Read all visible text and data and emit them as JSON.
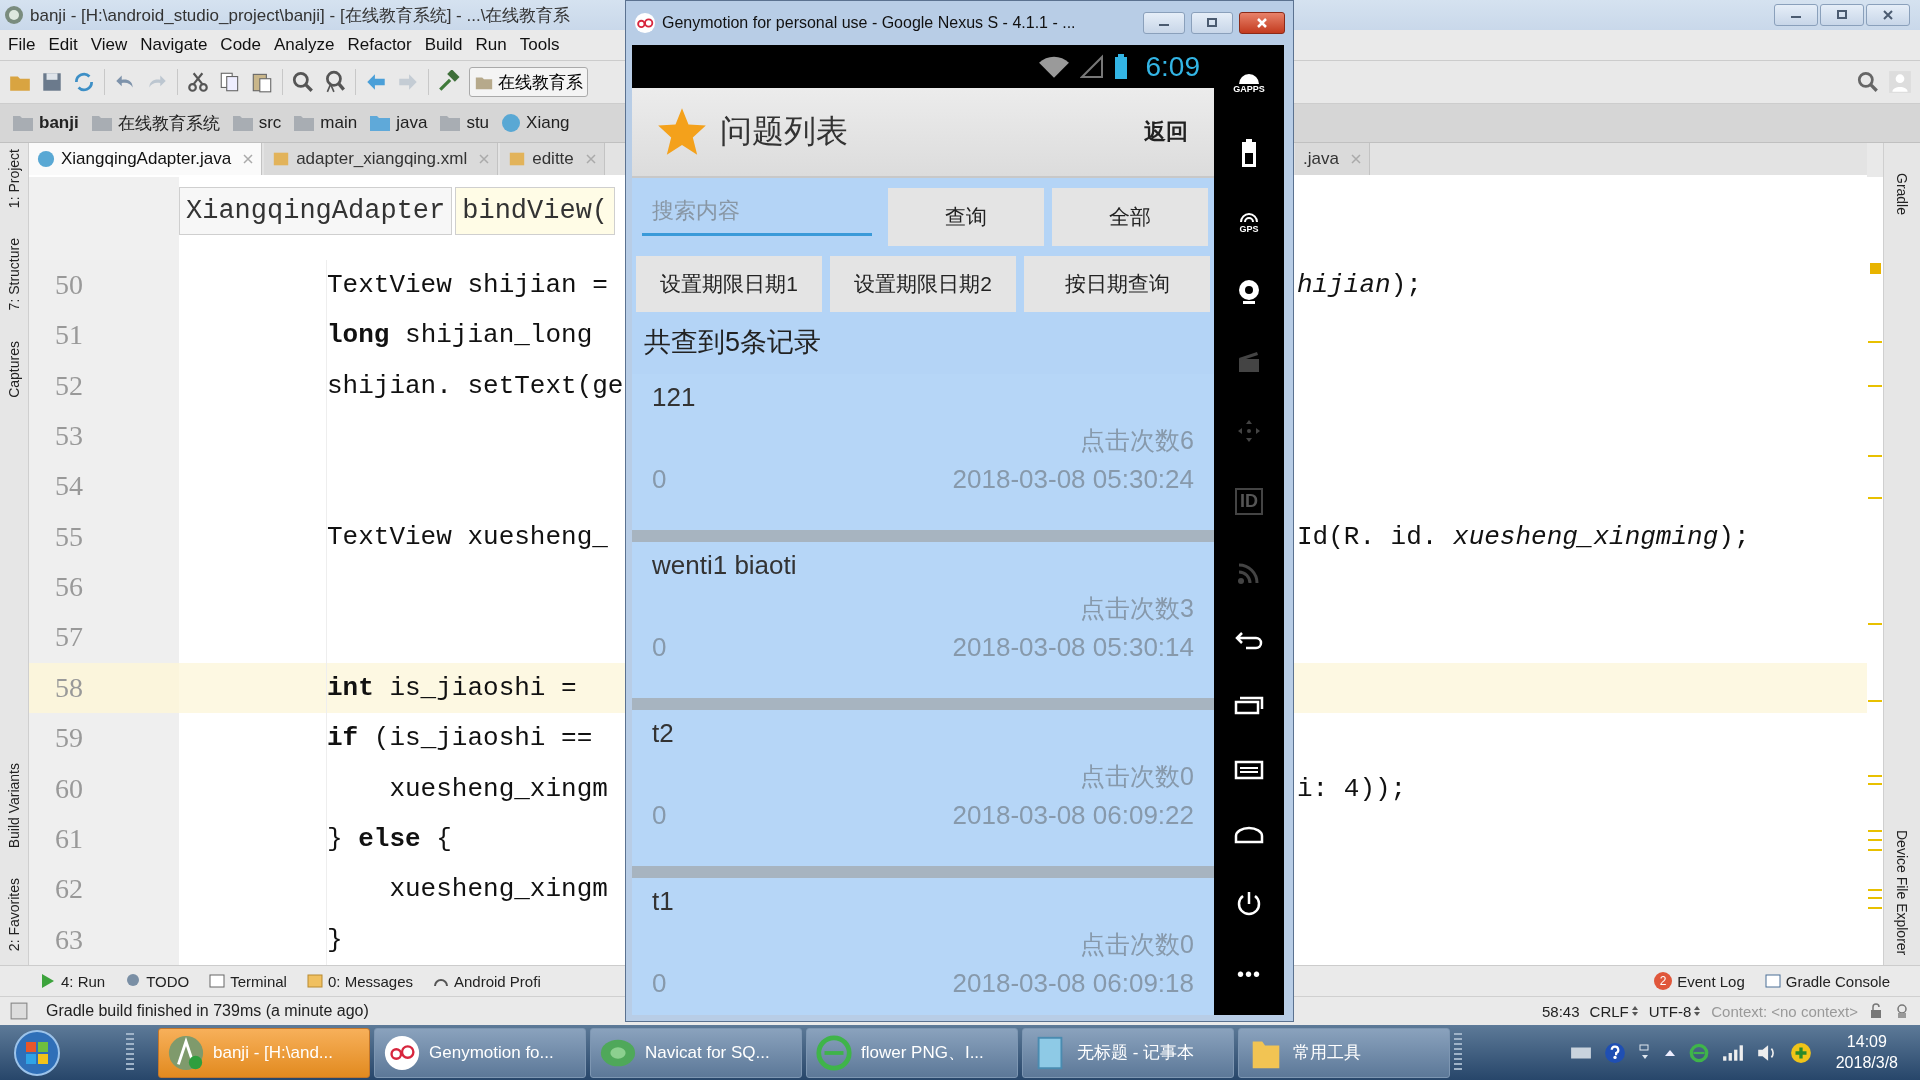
{
  "ide": {
    "title": "banji - [H:\\android_studio_project\\banji] - [在线教育系统] - ...\\在线教育系",
    "menu": [
      "File",
      "Edit",
      "View",
      "Navigate",
      "Code",
      "Analyze",
      "Refactor",
      "Build",
      "Run",
      "Tools"
    ],
    "run_config": "在线教育系",
    "breadcrumb": [
      {
        "label": "banji",
        "kind": "module"
      },
      {
        "label": "在线教育系统",
        "kind": "folder"
      },
      {
        "label": "src",
        "kind": "folder"
      },
      {
        "label": "main",
        "kind": "folder"
      },
      {
        "label": "java",
        "kind": "source"
      },
      {
        "label": "stu",
        "kind": "package"
      },
      {
        "label": "Xiang",
        "kind": "class"
      }
    ],
    "tabs": [
      {
        "label": "XiangqingAdapter.java",
        "kind": "java",
        "selected": true
      },
      {
        "label": "adapter_xiangqing.xml",
        "kind": "xml",
        "selected": false
      },
      {
        "label": "editte",
        "kind": "xml",
        "selected": false
      }
    ],
    "tabs_right": [
      {
        "label": ".java",
        "selected": false
      }
    ],
    "left_tools": [
      "1: Project",
      "7: Structure",
      "Captures",
      "Build Variants",
      "2: Favorites"
    ],
    "right_tools": [
      "Gradle",
      "Device File Explorer"
    ],
    "editor": {
      "class_crumb": "XiangqingAdapter",
      "method_crumb": "bindView(",
      "lines": [
        {
          "number": "50",
          "left": "TextView shijian =",
          "right": "*hijian*);",
          "current": false
        },
        {
          "number": "51",
          "left": "**long** shijian_long",
          "current": false
        },
        {
          "number": "52",
          "left": "shijian. setText(ge",
          "current": false
        },
        {
          "number": "53",
          "current": false
        },
        {
          "number": "54",
          "current": false
        },
        {
          "number": "55",
          "left": "TextView xuesheng_",
          "right": "Id(R. id. *xuesheng_xingming*);",
          "current": false
        },
        {
          "number": "56",
          "current": false
        },
        {
          "number": "57",
          "current": false
        },
        {
          "number": "58",
          "left": "**int** is_jiaoshi =",
          "current": true
        },
        {
          "number": "59",
          "left": "**if** (is_jiaoshi ==",
          "current": false
        },
        {
          "number": "60",
          "left": "    xuesheng_xingm",
          "right": "i: 4));",
          "current": false
        },
        {
          "number": "61",
          "left": "} **else** {",
          "current": false
        },
        {
          "number": "62",
          "left": "    xuesheng_xingm",
          "current": false
        },
        {
          "number": "63",
          "left": "}",
          "current": false
        }
      ]
    },
    "tool_windows": [
      {
        "label": "4: Run",
        "kind": "run"
      },
      {
        "label": "TODO",
        "kind": "todo"
      },
      {
        "label": "Terminal",
        "kind": "terminal"
      },
      {
        "label": "0: Messages",
        "kind": "messages"
      },
      {
        "label": "Android Profi",
        "kind": "profiler"
      }
    ],
    "tool_windows_right": [
      {
        "label": "Event Log",
        "badge": "2",
        "kind": "log"
      },
      {
        "label": "Gradle Console",
        "kind": "console"
      }
    ],
    "status": {
      "message": "Gradle build finished in 739ms (a minute ago)",
      "position": "58:43",
      "line_ending": "CRLF",
      "encoding": "UTF-8",
      "context": "Context: <no context>"
    }
  },
  "emulator": {
    "title": "Genymotion for personal use - Google Nexus S - 4.1.1 - ...",
    "clock": "6:09",
    "app_title": "问题列表",
    "back": "返回",
    "search_placeholder": "搜索内容",
    "buttons": [
      "查询",
      "全部"
    ],
    "date_buttons": [
      "设置期限日期1",
      "设置期限日期2",
      "按日期查询"
    ],
    "summary": "共查到5条记录",
    "items": [
      {
        "title": "121",
        "clicks": "点击次数6",
        "count": "0",
        "time": "2018-03-08 05:30:24"
      },
      {
        "title": "wenti1 biaoti",
        "clicks": "点击次数3",
        "count": "0",
        "time": "2018-03-08 05:30:14"
      },
      {
        "title": "t2",
        "clicks": "点击次数0",
        "count": "0",
        "time": "2018-03-08 06:09:22"
      },
      {
        "title": "t1",
        "clicks": "点击次数0",
        "count": "0",
        "time": "2018-03-08 06:09:18"
      }
    ],
    "side_controls": [
      {
        "kind": "gapps",
        "label": "GAPPS"
      },
      {
        "kind": "battery"
      },
      {
        "kind": "gps",
        "label": "GPS"
      },
      {
        "kind": "camera"
      },
      {
        "kind": "video"
      },
      {
        "kind": "dpad"
      },
      {
        "kind": "id",
        "label": "ID"
      },
      {
        "kind": "cast"
      },
      {
        "kind": "back"
      },
      {
        "kind": "recent"
      },
      {
        "kind": "menu"
      },
      {
        "kind": "home"
      },
      {
        "kind": "power"
      },
      {
        "kind": "more",
        "label": "•••"
      }
    ]
  },
  "taskbar": {
    "items": [
      {
        "label": "banji - [H:\\and...",
        "kind": "studio",
        "selected": true
      },
      {
        "label": "Genymotion fo...",
        "kind": "genymotion",
        "selected": false
      },
      {
        "label": "Navicat for SQ...",
        "kind": "navicat",
        "selected": false
      },
      {
        "label": "flower PNG、I...",
        "kind": "browser",
        "selected": false
      },
      {
        "label": "无标题 - 记事本",
        "kind": "notepad",
        "selected": false
      },
      {
        "label": "常用工具",
        "kind": "folder",
        "selected": false
      }
    ],
    "time": "14:09",
    "date": "2018/3/8"
  }
}
